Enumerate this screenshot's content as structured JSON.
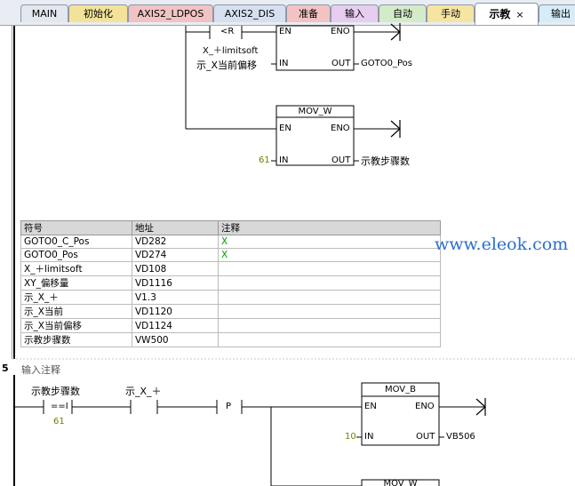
{
  "tabs": [
    {
      "label": "MAIN",
      "color": "#e3e7ee"
    },
    {
      "label": "初始化",
      "color": "#f3e39a"
    },
    {
      "label": "AXIS2_LDPOS",
      "color": "#f1c3c3"
    },
    {
      "label": "AXIS2_DIS",
      "color": "#d6e0f0"
    },
    {
      "label": "准备",
      "color": "#f3c3c3"
    },
    {
      "label": "输入",
      "color": "#e7cdef"
    },
    {
      "label": "自动",
      "color": "#d3ebc8"
    },
    {
      "label": "手动",
      "color": "#f6e4a3"
    },
    {
      "label": "示教",
      "color": "#ffffff",
      "close": "×"
    },
    {
      "label": "输出",
      "color": "#d6ecf6"
    }
  ],
  "net4": {
    "contact1": "<R",
    "contact1_label": "X_＋limitsoft",
    "block1": {
      "en": "EN",
      "eno": "ENO",
      "in": "IN",
      "out": "OUT",
      "in_var": "示_X当前偏移",
      "out_var": "GOTO0_Pos"
    },
    "block2": {
      "title": "MOV_W",
      "en": "EN",
      "eno": "ENO",
      "in": "IN",
      "out": "OUT",
      "in_val": "61",
      "out_var": "示教步骤数"
    }
  },
  "symbol_table": {
    "headers": [
      "符号",
      "地址",
      "注释"
    ],
    "rows": [
      {
        "symbol": "GOTO0_C_Pos",
        "address": "VD282",
        "comment": "X"
      },
      {
        "symbol": "GOTO0_Pos",
        "address": "VD274",
        "comment": "X"
      },
      {
        "symbol": "X_＋limitsoft",
        "address": "VD108",
        "comment": ""
      },
      {
        "symbol": "XY_偏移量",
        "address": "VD1116",
        "comment": ""
      },
      {
        "symbol": "示_X_＋",
        "address": "V1.3",
        "comment": ""
      },
      {
        "symbol": "示_X当前",
        "address": "VD1120",
        "comment": ""
      },
      {
        "symbol": "示_X当前偏移",
        "address": "VD1124",
        "comment": ""
      },
      {
        "symbol": "示教步骤数",
        "address": "VW500",
        "comment": ""
      }
    ]
  },
  "watermark": "www.eleok.com",
  "net5": {
    "number": "5",
    "comment": "输入注释",
    "cmp_var": "示教步骤数",
    "cmp_op": "==I",
    "cmp_val": "61",
    "contact_var": "示_X_＋",
    "p_label": "P",
    "block1": {
      "title": "MOV_B",
      "en": "EN",
      "eno": "ENO",
      "in": "IN",
      "out": "OUT",
      "in_val": "10",
      "out_var": "VB506"
    },
    "block2": {
      "title": "MOV_W"
    }
  }
}
